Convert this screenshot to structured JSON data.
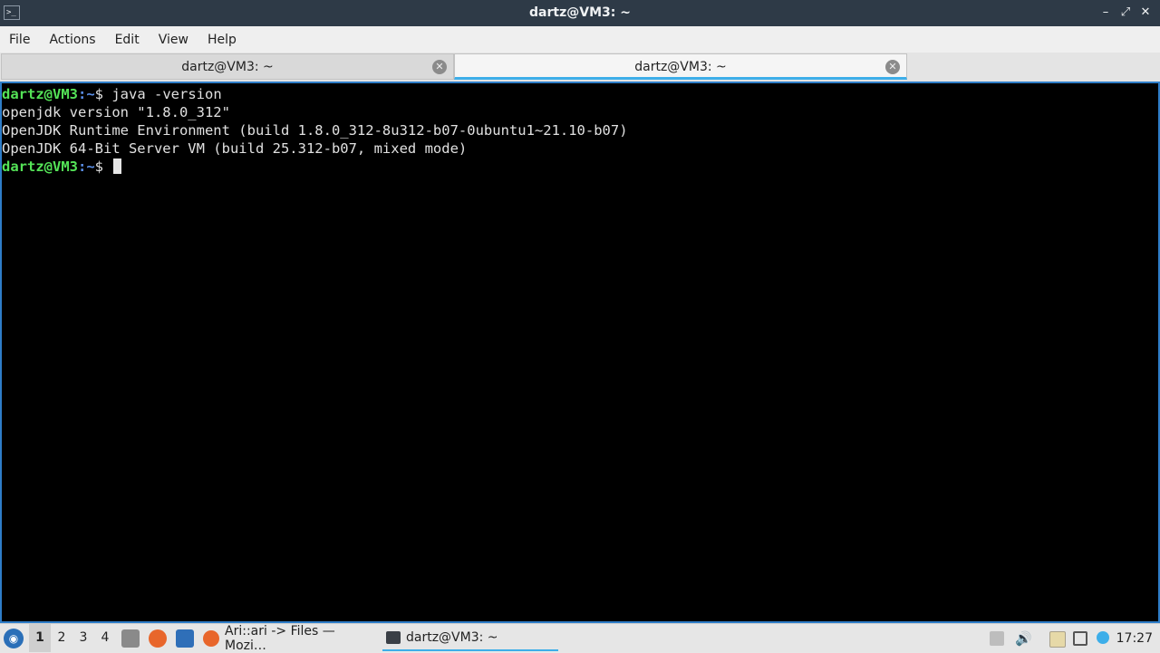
{
  "window": {
    "title": "dartz@VM3: ~",
    "app_icon_glyph": ">_"
  },
  "menu": [
    "File",
    "Actions",
    "Edit",
    "View",
    "Help"
  ],
  "tabs": [
    {
      "label": "dartz@VM3: ~",
      "active": false
    },
    {
      "label": "dartz@VM3: ~",
      "active": true
    }
  ],
  "terminal": {
    "prompt_user": "dartz@VM3",
    "prompt_path": ":~",
    "prompt_symbol": "$ ",
    "command": "java -version",
    "output": [
      "openjdk version \"1.8.0_312\"",
      "OpenJDK Runtime Environment (build 1.8.0_312-8u312-b07-0ubuntu1~21.10-b07)",
      "OpenJDK 64-Bit Server VM (build 25.312-b07, mixed mode)"
    ]
  },
  "taskbar": {
    "workspaces": [
      "1",
      "2",
      "3",
      "4"
    ],
    "active_workspace": "1",
    "tasks": [
      {
        "label": "Ari::ari -> Files — Mozi…",
        "icon": "firefox-icon"
      },
      {
        "label": "dartz@VM3: ~",
        "icon": "terminal-icon"
      }
    ],
    "clock": "17:27"
  },
  "colors": {
    "accent": "#3daee9",
    "prompt_user": "#54e357",
    "prompt_path": "#5a8fe8",
    "terminal_bg": "#000000"
  }
}
